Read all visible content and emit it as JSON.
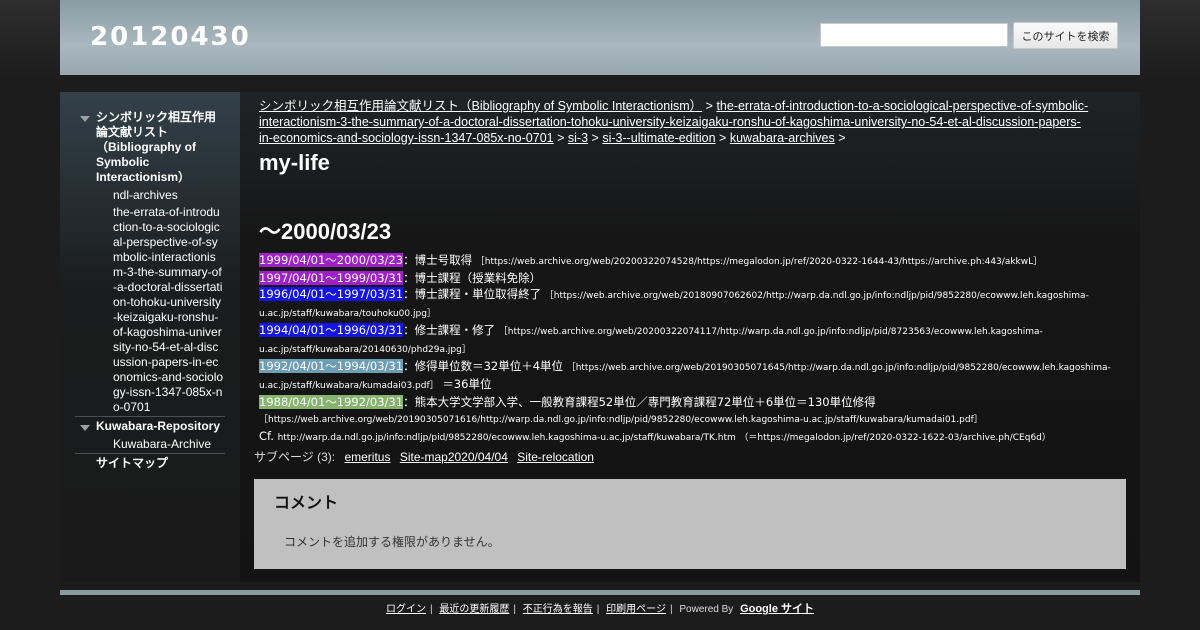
{
  "header": {
    "site_title": "20120430",
    "search_placeholder": "",
    "search_button": "このサイトを検索"
  },
  "sidebar": {
    "sections": [
      {
        "title": "シンボリック相互作用論文献リスト（Bibliography of Symbolic Interactionism）",
        "items": [
          "ndl-archives",
          "the-errata-of-introduction-to-a-sociological-perspective-of-symbolic-interactionism-3-the-summary-of-a-doctoral-dissertation-tohoku-university-keizaigaku-ronshu-of-kagoshima-university-no-54-et-al-discussion-papers-in-economics-and-sociology-issn-1347-085x-no-0701"
        ]
      },
      {
        "title": "Kuwabara-Repository",
        "items": [
          "Kuwabara-Archive"
        ]
      },
      {
        "title": "サイトマップ",
        "items": []
      }
    ]
  },
  "breadcrumb": {
    "links": [
      "シンボリック相互作用論文献リスト（Bibliography of Symbolic Interactionism）",
      "the-errata-of-introduction-to-a-sociological-perspective-of-symbolic-interactionism-3-the-summary-of-a-doctoral-dissertation-tohoku-university-keizaigaku-ronshu-of-kagoshima-university-no-54-et-al-discussion-papers-in-economics-and-sociology-issn-1347-085x-no-0701",
      "si-3",
      "si-3--ultimate-edition",
      "kuwabara-archives"
    ],
    "separator": ">"
  },
  "page": {
    "title": "my-life",
    "section_heading": "～2000/03/23"
  },
  "entries": [
    {
      "date": "1999/04/01～2000/03/23",
      "color": "#a020c8",
      "text": "：博士号取得",
      "note": "［https://web.archive.org/web/20200322074528/https://megalodon.jp/ref/2020-0322-1644-43/https://archive.ph:443/akkwL］",
      "tail": ""
    },
    {
      "date": "1997/04/01～1999/03/31",
      "color": "#a020c8",
      "text": "：博士課程（授業料免除）",
      "note": "",
      "tail": ""
    },
    {
      "date": "1996/04/01～1997/03/31",
      "color": "#1414e6",
      "text": "：博士課程・単位取得終了",
      "note": "［https://web.archive.org/web/20180907062602/http://warp.da.ndl.go.jp/info:ndljp/pid/9852280/ecowww.leh.kagoshima-u.ac.jp/staff/kuwabara/touhoku00.jpg］",
      "tail": ""
    },
    {
      "date": "1994/04/01～1996/03/31",
      "color": "#1414e6",
      "text": "：修士課程・修了",
      "note": "［https://web.archive.org/web/20200322074117/http://warp.da.ndl.go.jp/info:ndljp/pid/8723563/ecowww.leh.kagoshima-u.ac.jp/staff/kuwabara/20140630/phd29a.jpg］",
      "tail": ""
    },
    {
      "date": "1992/04/01～1994/03/31",
      "color": "#6e9eb6",
      "text": "：修得単位数＝32単位＋4単位",
      "note": "［https://web.archive.org/web/20190305071645/http://warp.da.ndl.go.jp/info:ndljp/pid/9852280/ecowww.leh.kagoshima-u.ac.jp/staff/kuwabara/kumadai03.pdf］",
      "tail": "＝36単位"
    },
    {
      "date": "1988/04/01～1992/03/31",
      "color": "#86b46e",
      "text": "：熊本大学文学部入学、一般教育課程52単位／専門教育課程72単位＋6単位＝130単位修得",
      "note": "［https://web.archive.org/web/20190305071616/http://warp.da.ndl.go.jp/info:ndljp/pid/9852280/ecowww.leh.kagoshima-u.ac.jp/staff/kuwabara/kumadai01.pdf］",
      "tail": ""
    }
  ],
  "cf": {
    "prefix": "Cf.",
    "url": "http://warp.da.ndl.go.jp/info:ndljp/pid/9852280/ecowww.leh.kagoshima-u.ac.jp/staff/kuwabara/TK.htm",
    "alt": "（＝https://megalodon.jp/ref/2020-0322-1622-03/archive.ph/CEq6d）"
  },
  "subpages": {
    "label": "サブページ (3):",
    "links": [
      "emeritus",
      "Site-map2020/04/04",
      "Site-relocation"
    ]
  },
  "comments": {
    "heading": "コメント",
    "message": "コメントを追加する権限がありません。"
  },
  "footer": {
    "links": [
      "ログイン",
      "最近の更新履歴",
      "不正行為を報告",
      "印刷用ページ"
    ],
    "powered_by": "Powered By",
    "google_sites": "Google サイト"
  }
}
